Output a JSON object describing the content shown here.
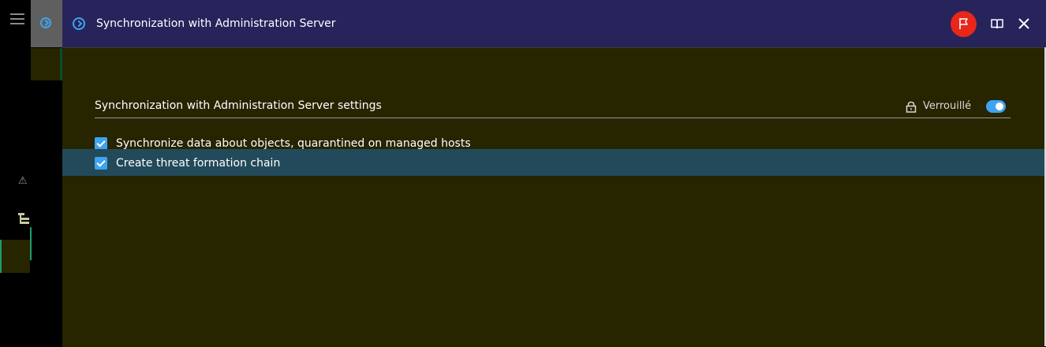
{
  "header": {
    "title": "Synchronization with Administration Server",
    "icons": [
      "chevron-circle-icon",
      "flag-icon",
      "book-icon",
      "close-icon"
    ],
    "flag_color": "#e8261a"
  },
  "settings": {
    "section_title": "Synchronization with Administration Server settings",
    "lock_label": "Verrouillé",
    "lock_enabled": true,
    "options": [
      {
        "label": "Synchronize data about objects, quarantined on managed hosts",
        "checked": true
      },
      {
        "label": "Create threat formation chain",
        "checked": true
      }
    ]
  },
  "colors": {
    "accent": "#3fa3f0",
    "header_bg": "#26245b",
    "panel_bg": "#272400",
    "selected_row": "#224a5a"
  }
}
